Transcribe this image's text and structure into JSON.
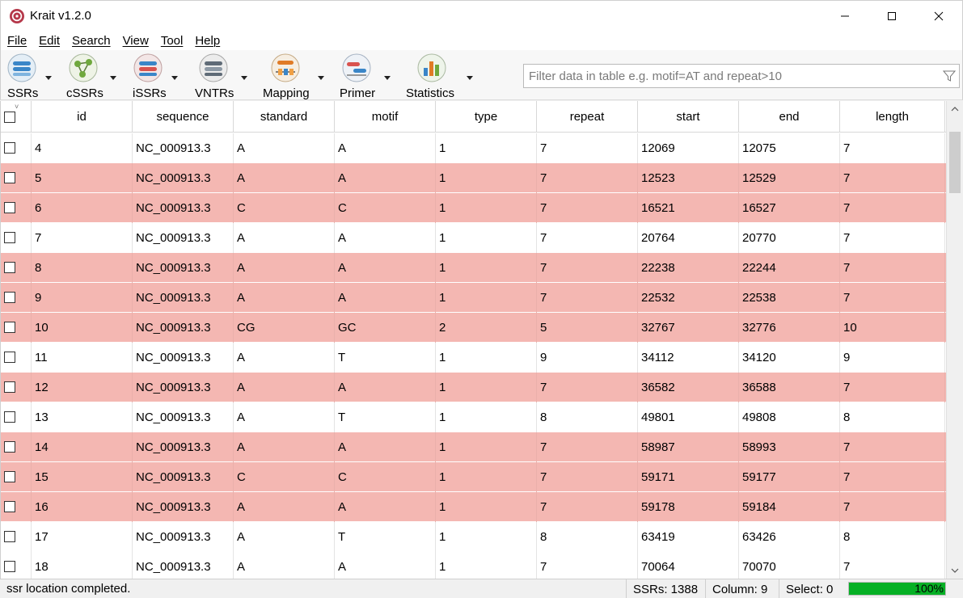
{
  "window": {
    "title": "Krait v1.2.0"
  },
  "menu": [
    "File",
    "Edit",
    "Search",
    "View",
    "Tool",
    "Help"
  ],
  "toolbar": {
    "tools": [
      {
        "label": "SSRs",
        "icon": "ssrs-icon"
      },
      {
        "label": "cSSRs",
        "icon": "cssrs-icon"
      },
      {
        "label": "iSSRs",
        "icon": "issrs-icon"
      },
      {
        "label": "VNTRs",
        "icon": "vntrs-icon"
      },
      {
        "label": "Mapping",
        "icon": "mapping-icon"
      },
      {
        "label": "Primer",
        "icon": "primer-icon"
      },
      {
        "label": "Statistics",
        "icon": "statistics-icon"
      }
    ],
    "filter_placeholder": "Filter data in table e.g. motif=AT and repeat>10",
    "filter_value": ""
  },
  "table": {
    "columns": [
      "id",
      "sequence",
      "standard",
      "motif",
      "type",
      "repeat",
      "start",
      "end",
      "length"
    ],
    "rows": [
      {
        "id": "4",
        "sequence": "NC_000913.3",
        "standard": "A",
        "motif": "A",
        "type": "1",
        "repeat": "7",
        "start": "12069",
        "end": "12075",
        "length": "7",
        "highlight": false
      },
      {
        "id": "5",
        "sequence": "NC_000913.3",
        "standard": "A",
        "motif": "A",
        "type": "1",
        "repeat": "7",
        "start": "12523",
        "end": "12529",
        "length": "7",
        "highlight": true
      },
      {
        "id": "6",
        "sequence": "NC_000913.3",
        "standard": "C",
        "motif": "C",
        "type": "1",
        "repeat": "7",
        "start": "16521",
        "end": "16527",
        "length": "7",
        "highlight": true
      },
      {
        "id": "7",
        "sequence": "NC_000913.3",
        "standard": "A",
        "motif": "A",
        "type": "1",
        "repeat": "7",
        "start": "20764",
        "end": "20770",
        "length": "7",
        "highlight": false
      },
      {
        "id": "8",
        "sequence": "NC_000913.3",
        "standard": "A",
        "motif": "A",
        "type": "1",
        "repeat": "7",
        "start": "22238",
        "end": "22244",
        "length": "7",
        "highlight": true
      },
      {
        "id": "9",
        "sequence": "NC_000913.3",
        "standard": "A",
        "motif": "A",
        "type": "1",
        "repeat": "7",
        "start": "22532",
        "end": "22538",
        "length": "7",
        "highlight": true
      },
      {
        "id": "10",
        "sequence": "NC_000913.3",
        "standard": "CG",
        "motif": "GC",
        "type": "2",
        "repeat": "5",
        "start": "32767",
        "end": "32776",
        "length": "10",
        "highlight": true
      },
      {
        "id": "11",
        "sequence": "NC_000913.3",
        "standard": "A",
        "motif": "T",
        "type": "1",
        "repeat": "9",
        "start": "34112",
        "end": "34120",
        "length": "9",
        "highlight": false
      },
      {
        "id": "12",
        "sequence": "NC_000913.3",
        "standard": "A",
        "motif": "A",
        "type": "1",
        "repeat": "7",
        "start": "36582",
        "end": "36588",
        "length": "7",
        "highlight": true
      },
      {
        "id": "13",
        "sequence": "NC_000913.3",
        "standard": "A",
        "motif": "T",
        "type": "1",
        "repeat": "8",
        "start": "49801",
        "end": "49808",
        "length": "8",
        "highlight": false
      },
      {
        "id": "14",
        "sequence": "NC_000913.3",
        "standard": "A",
        "motif": "A",
        "type": "1",
        "repeat": "7",
        "start": "58987",
        "end": "58993",
        "length": "7",
        "highlight": true
      },
      {
        "id": "15",
        "sequence": "NC_000913.3",
        "standard": "C",
        "motif": "C",
        "type": "1",
        "repeat": "7",
        "start": "59171",
        "end": "59177",
        "length": "7",
        "highlight": true
      },
      {
        "id": "16",
        "sequence": "NC_000913.3",
        "standard": "A",
        "motif": "A",
        "type": "1",
        "repeat": "7",
        "start": "59178",
        "end": "59184",
        "length": "7",
        "highlight": true
      },
      {
        "id": "17",
        "sequence": "NC_000913.3",
        "standard": "A",
        "motif": "T",
        "type": "1",
        "repeat": "8",
        "start": "63419",
        "end": "63426",
        "length": "8",
        "highlight": false
      },
      {
        "id": "18",
        "sequence": "NC_000913.3",
        "standard": "A",
        "motif": "A",
        "type": "1",
        "repeat": "7",
        "start": "70064",
        "end": "70070",
        "length": "7",
        "highlight": false
      }
    ]
  },
  "status": {
    "message": "ssr location completed.",
    "ssrs": "SSRs: 1388",
    "column": "Column: 9",
    "select": "Select: 0",
    "progress_percent": 100,
    "progress_text": "100%"
  },
  "colors": {
    "row_highlight": "#f4b7b2",
    "progress": "#06b025"
  }
}
